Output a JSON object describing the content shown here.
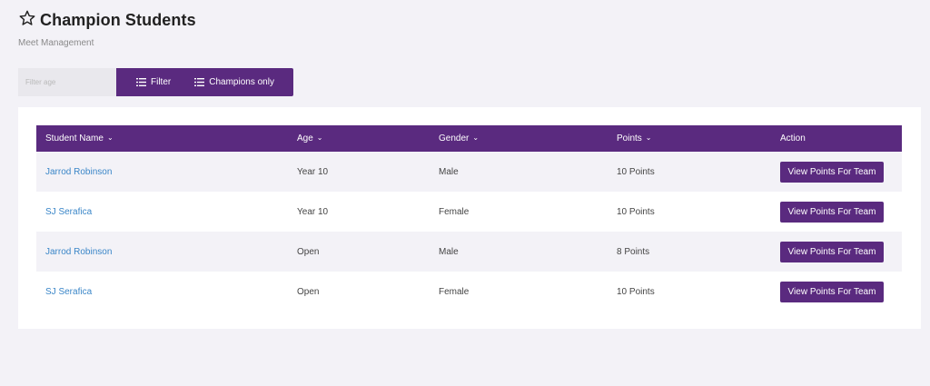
{
  "header": {
    "title": "Champion Students",
    "subtitle": "Meet Management",
    "icon": "star-outline-icon"
  },
  "toolbar": {
    "age_placeholder": "Filter age",
    "filter_label": "Filter",
    "champions_label": "Champions only"
  },
  "table": {
    "columns": [
      "Student Name",
      "Age",
      "Gender",
      "Points",
      "Action"
    ],
    "rows": [
      {
        "name": "Jarrod Robinson",
        "age": "Year 10",
        "gender": "Male",
        "points": "10 Points",
        "action": "View Points For Team"
      },
      {
        "name": "SJ Serafica",
        "age": "Year 10",
        "gender": "Female",
        "points": "10 Points",
        "action": "View Points For Team"
      },
      {
        "name": "Jarrod Robinson",
        "age": "Open",
        "gender": "Male",
        "points": "8 Points",
        "action": "View Points For Team"
      },
      {
        "name": "SJ Serafica",
        "age": "Open",
        "gender": "Female",
        "points": "10 Points",
        "action": "View Points For Team"
      }
    ]
  },
  "colors": {
    "accent": "#5a2a7f",
    "link": "#3a86c8",
    "background": "#f3f2f7"
  }
}
